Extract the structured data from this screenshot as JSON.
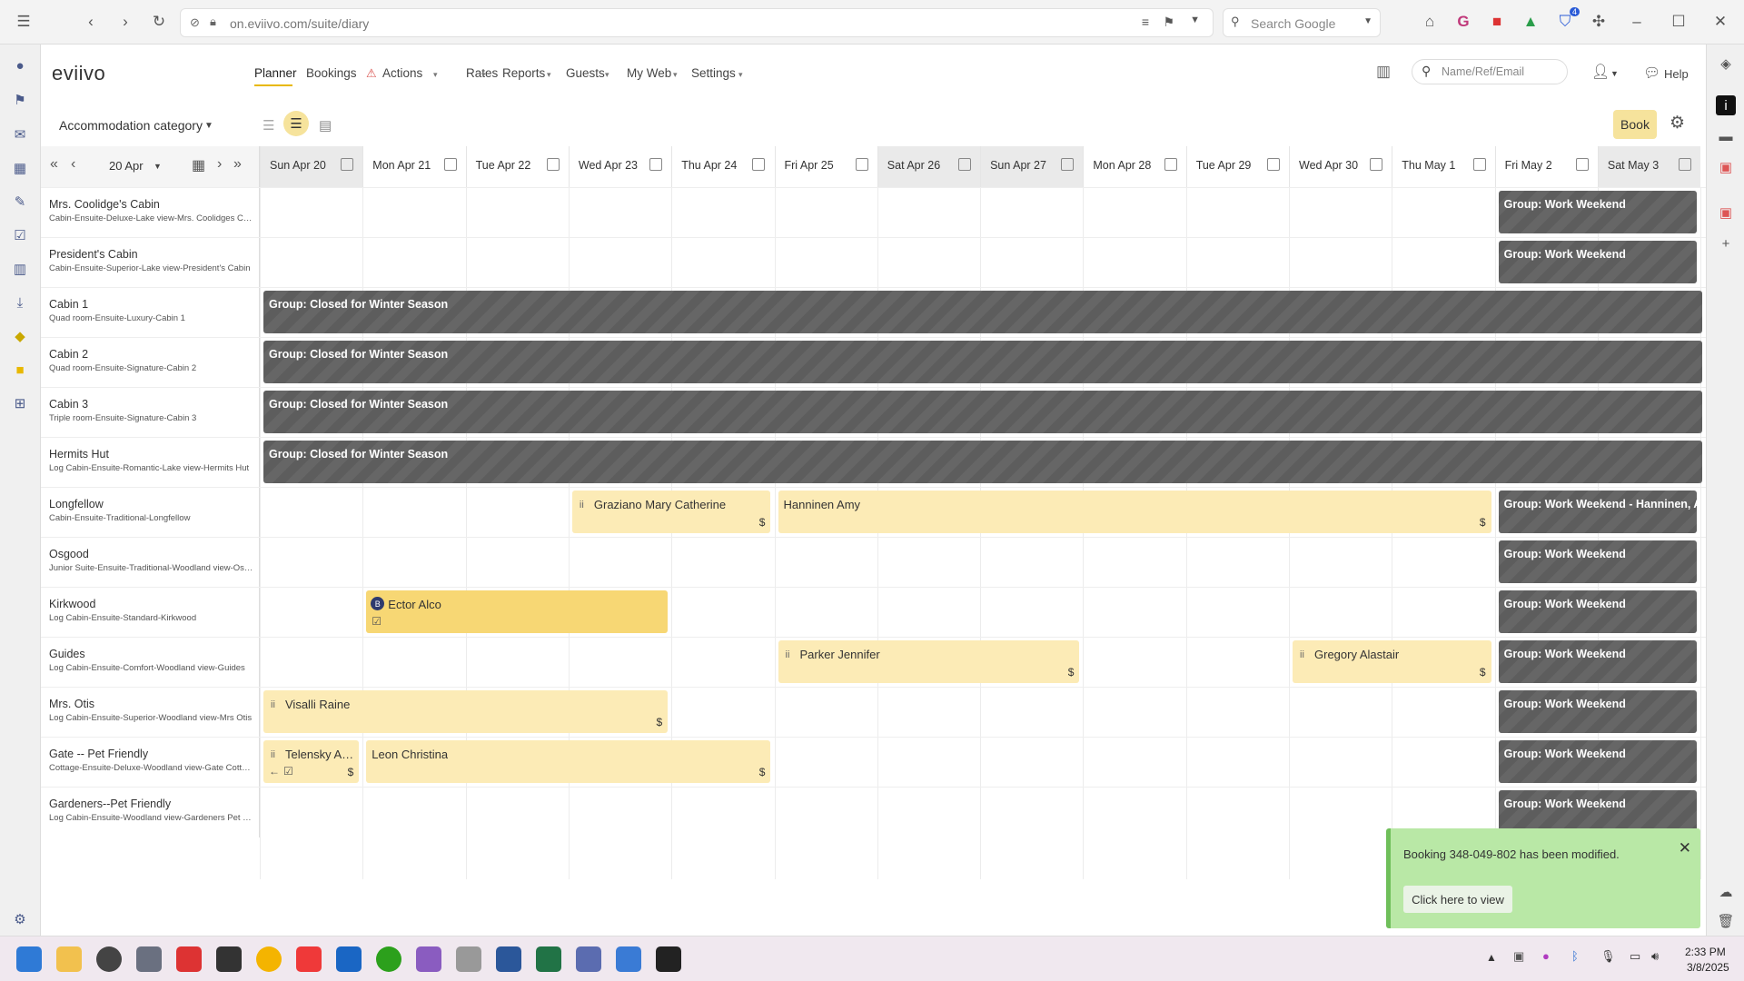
{
  "browser": {
    "url": "on.eviivo.com/suite/diary",
    "search_placeholder": "Search Google",
    "notification_badge": "4"
  },
  "app": {
    "logo": "eviivo",
    "nav": [
      {
        "label": "Planner",
        "active": true
      },
      {
        "label": "Bookings"
      },
      {
        "label": "Actions"
      },
      {
        "label": "Rates"
      },
      {
        "label": "Reports"
      },
      {
        "label": "Guests"
      },
      {
        "label": "My Web"
      },
      {
        "label": "Settings"
      }
    ],
    "name_search_placeholder": "Name/Ref/Email",
    "help_label": "Help",
    "accommodation_category": "Accommodation category",
    "book_label": "Book"
  },
  "grid": {
    "current_date": "20 Apr",
    "days": [
      {
        "label": "Sun Apr 20"
      },
      {
        "label": "Mon Apr 21"
      },
      {
        "label": "Tue Apr 22"
      },
      {
        "label": "Wed Apr 23"
      },
      {
        "label": "Thu Apr 24"
      },
      {
        "label": "Fri Apr 25"
      },
      {
        "label": "Sat Apr 26"
      },
      {
        "label": "Sun Apr 27"
      },
      {
        "label": "Mon Apr 28"
      },
      {
        "label": "Tue Apr 29"
      },
      {
        "label": "Wed Apr 30"
      },
      {
        "label": "Thu May 1"
      },
      {
        "label": "Fri May 2"
      },
      {
        "label": "Sat May 3"
      }
    ],
    "rooms": [
      {
        "name": "Mrs. Coolidge's Cabin",
        "desc": "Cabin-Ensuite-Deluxe-Lake view-Mrs. Coolidges Cabin"
      },
      {
        "name": "President's Cabin",
        "desc": "Cabin-Ensuite-Superior-Lake view-President's Cabin"
      },
      {
        "name": "Cabin 1",
        "desc": "Quad room-Ensuite-Luxury-Cabin 1"
      },
      {
        "name": "Cabin 2",
        "desc": "Quad room-Ensuite-Signature-Cabin 2"
      },
      {
        "name": "Cabin 3",
        "desc": "Triple room-Ensuite-Signature-Cabin 3"
      },
      {
        "name": "Hermits Hut",
        "desc": "Log Cabin-Ensuite-Romantic-Lake view-Hermits Hut"
      },
      {
        "name": "Longfellow",
        "desc": "Cabin-Ensuite-Traditional-Longfellow"
      },
      {
        "name": "Osgood",
        "desc": "Junior Suite-Ensuite-Traditional-Woodland view-Osgood"
      },
      {
        "name": "Kirkwood",
        "desc": "Log Cabin-Ensuite-Standard-Kirkwood"
      },
      {
        "name": "Guides",
        "desc": "Log Cabin-Ensuite-Comfort-Woodland view-Guides"
      },
      {
        "name": "Mrs. Otis",
        "desc": "Log Cabin-Ensuite-Superior-Woodland view-Mrs Otis"
      },
      {
        "name": "Gate -- Pet Friendly",
        "desc": "Cottage-Ensuite-Deluxe-Woodland view-Gate Cottage"
      },
      {
        "name": "Gardeners--Pet Friendly",
        "desc": "Log Cabin-Ensuite-Woodland view-Gardeners Pet Friendly"
      }
    ],
    "bookings": {
      "work_weekend": "Group: Work Weekend",
      "closed_winter": "Group: Closed for Winter Season",
      "work_weekend_hanninen": "Group: Work Weekend - Hanninen, Amy",
      "graziano": "Graziano Mary Catherine",
      "hanninen": "Hanninen Amy",
      "ector": "Ector Alco",
      "parker": "Parker Jennifer",
      "gregory": "Gregory Alastair",
      "visalli": "Visalli Raine",
      "telensky": "Telensky An...",
      "leon": "Leon Christina",
      "dollar": "$",
      "ector_badge": "B"
    }
  },
  "toast": {
    "message": "Booking 348-049-802 has been modified.",
    "button": "Click here to view"
  },
  "taskbar": {
    "time": "2:33 PM",
    "date": "3/8/2025"
  }
}
